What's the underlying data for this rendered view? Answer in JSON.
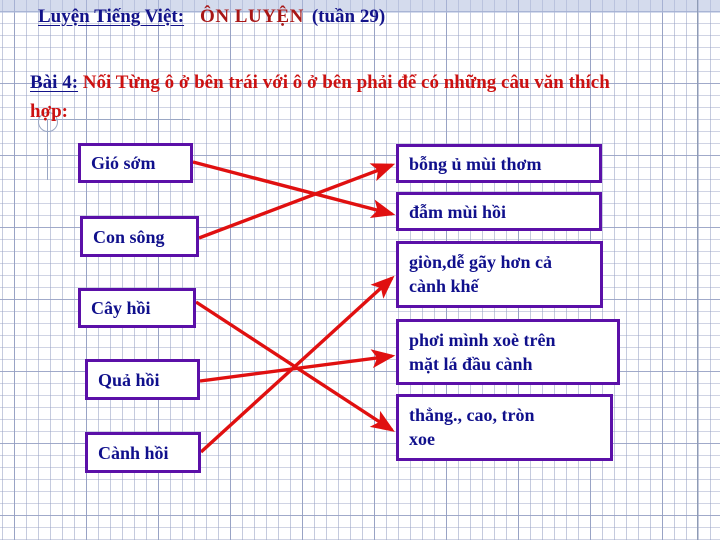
{
  "header": {
    "subject": "Luyện Tiếng Việt:",
    "main_title": "ÔN LUYỆN",
    "week": "(tuần 29)"
  },
  "exercise": {
    "label": "Bài 4:",
    "instruction": "Nối Từng ô ở bên trái với ô ở bên phải để có những câu văn thích hợp:"
  },
  "colors": {
    "box_border": "#5B10A8",
    "box_text": "#10108c",
    "connector": "#E01010",
    "title_blue": "#13138a",
    "title_red": "#a81616",
    "prompt_red": "#cc1111",
    "grid": "#96a0c3"
  },
  "left_column": [
    {
      "id": "left-1",
      "text": "Gió sớm"
    },
    {
      "id": "left-2",
      "text": "Con sông"
    },
    {
      "id": "left-3",
      "text": "Cây hồi"
    },
    {
      "id": "left-4",
      "text": "Quả hồi"
    },
    {
      "id": "left-5",
      "text": "Cành hồi"
    }
  ],
  "right_column": [
    {
      "id": "right-1",
      "line1": "bỗng ủ mùi thơm",
      "line2": ""
    },
    {
      "id": "right-2",
      "line1": "đẫm mùi hồi",
      "line2": ""
    },
    {
      "id": "right-3",
      "line1": "giòn,dễ gãy hơn cả",
      "line2": "cành khế"
    },
    {
      "id": "right-4",
      "line1": "phơi mình xoè trên",
      "line2": "mặt lá đầu cành"
    },
    {
      "id": "right-5",
      "line1": "thẳng., cao, tròn",
      "line2": "xoe"
    }
  ],
  "connections": [
    {
      "from": "left-1",
      "to": "right-2"
    },
    {
      "from": "left-2",
      "to": "right-1"
    },
    {
      "from": "left-3",
      "to": "right-5"
    },
    {
      "from": "left-4",
      "to": "right-4"
    },
    {
      "from": "left-5",
      "to": "right-3"
    }
  ]
}
